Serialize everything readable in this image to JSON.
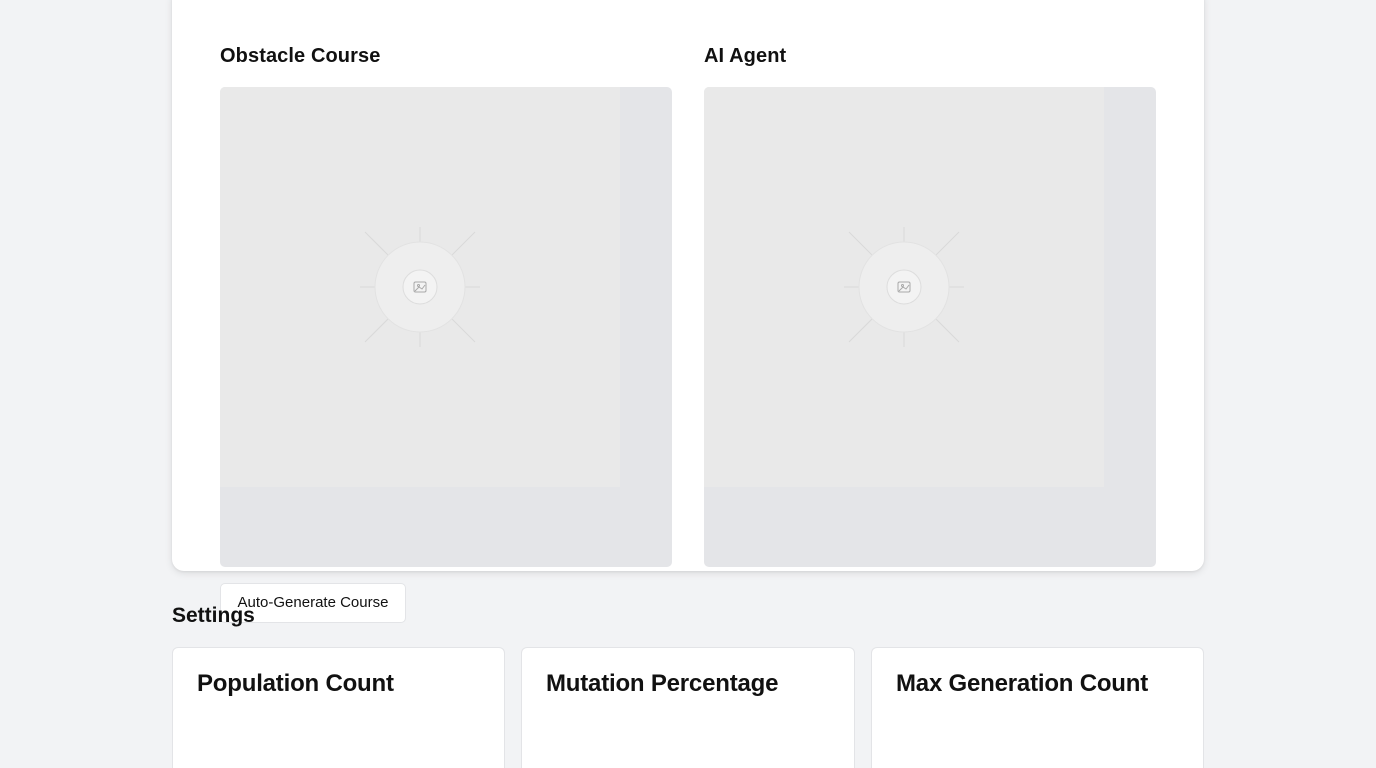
{
  "main": {
    "panels": [
      {
        "title": "Obstacle Course",
        "image_icon": "image-placeholder-icon"
      },
      {
        "title": "AI Agent",
        "image_icon": "image-placeholder-icon"
      }
    ],
    "auto_generate_label": "Auto-Generate Course"
  },
  "settings": {
    "heading": "Settings",
    "cards": [
      {
        "title": "Population Count"
      },
      {
        "title": "Mutation Percentage"
      },
      {
        "title": "Max Generation Count"
      }
    ]
  },
  "colors": {
    "page_background": "#f2f3f5",
    "card_background": "#ffffff",
    "panel_background": "#e4e5e8",
    "image_placeholder": "#e9e9e9",
    "text": "#111111"
  }
}
